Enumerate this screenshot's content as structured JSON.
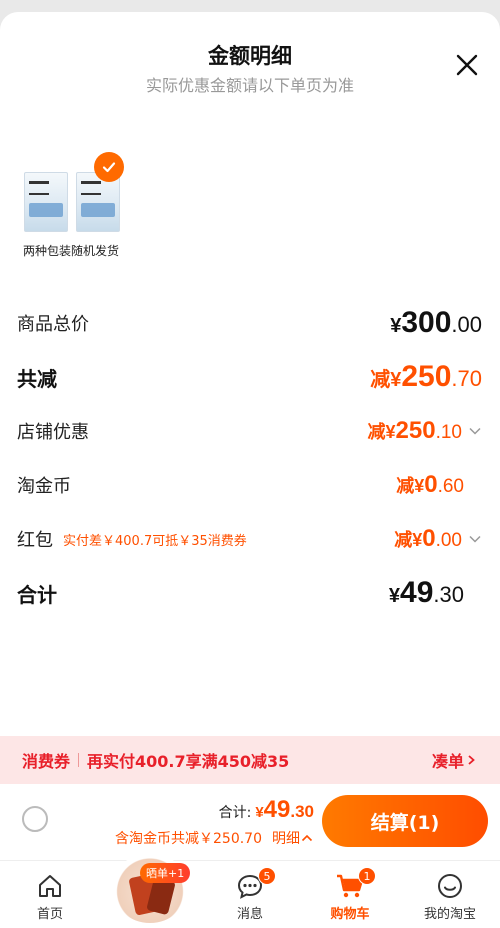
{
  "sheet": {
    "title": "金额明细",
    "subtitle": "实际优惠金额请以下单页为准"
  },
  "product": {
    "caption": "两种包装随机发货",
    "selected": true
  },
  "rows": {
    "goods_total": {
      "label": "商品总价",
      "prefix": "¥",
      "int": "300",
      "dec": ".00"
    },
    "total_reduce": {
      "label": "共减",
      "prefix": "减¥",
      "int": "250",
      "dec": ".70"
    },
    "shop_discount": {
      "label": "店铺优惠",
      "prefix": "减¥",
      "int": "250",
      "dec": ".10"
    },
    "taobao_coin": {
      "label": "淘金币",
      "prefix": "减¥",
      "int": "0",
      "dec": ".60"
    },
    "red_packet": {
      "label": "红包",
      "note": "实付差￥400.7可抵￥35消费券",
      "prefix": "减¥",
      "int": "0",
      "dec": ".00"
    },
    "sum": {
      "label": "合计",
      "prefix": "¥",
      "int": "49",
      "dec": ".30"
    }
  },
  "coupon_bar": {
    "tag": "消费券",
    "text": "再实付400.7享满450减35",
    "link": "凑单"
  },
  "checkout": {
    "total_label": "合计:",
    "total_prefix": "¥",
    "total_int": "49",
    "total_dec": ".30",
    "saved_text": "含淘金币共减￥250.70",
    "detail_link": "明细",
    "settle_button": "结算(1)"
  },
  "tabbar": {
    "home": "首页",
    "promo_badge": "晒单+1",
    "messages": "消息",
    "messages_badge": "5",
    "cart": "购物车",
    "cart_badge": "1",
    "mine": "我的淘宝"
  },
  "colors": {
    "accent": "#ff5000",
    "coupon_bg": "#fde6e6",
    "coupon_text": "#e8202a"
  }
}
